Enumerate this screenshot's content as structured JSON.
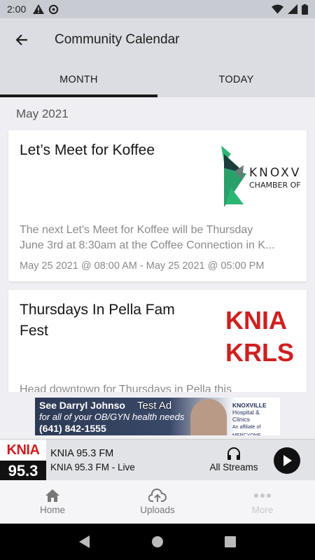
{
  "status_bar": {
    "time": "2:00"
  },
  "app_bar": {
    "title": "Community Calendar"
  },
  "tabs": [
    {
      "label": "MONTH"
    },
    {
      "label": "TODAY"
    }
  ],
  "calendar": {
    "month": "May 2021",
    "events": [
      {
        "title": "Let’s Meet for Koffee",
        "description_line1": "The next Let's Meet for Koffee will be Thursday",
        "description_line2": "June 3rd at 8:30am at the Coffee Connection in K...",
        "dates": "May 25 2021 @ 08:00 AM - May 25 2021 @ 05:00 PM",
        "thumb": {
          "line1": "KNOXV",
          "line2": "CHAMBER OF"
        }
      },
      {
        "title": "Thursdays In Pella Fam Fest",
        "description_line1": "Head downtown for Thursdays in Pella this",
        "thumb": {
          "line1": "KNIA",
          "line2": "KRLS"
        }
      }
    ]
  },
  "ad": {
    "headline": "See  Darryl Johnso",
    "line2": "for all of your OB/GYN health needs",
    "phone": "(641) 842-1555",
    "label": "Test Ad",
    "logo_line1": "KNOXVILLE",
    "logo_line2": "Hospital & Clinics",
    "logo_line3": "An affiliate of MERCYONE"
  },
  "player": {
    "logo_top": "KNIA",
    "logo_bottom": "95.3",
    "station": "KNIA 95.3 FM",
    "subtitle": "KNIA 95.3 FM - Live",
    "streams_label": "All Streams"
  },
  "bottom_nav": [
    {
      "label": "Home",
      "icon": "home-icon"
    },
    {
      "label": "Uploads",
      "icon": "cloud-upload-icon"
    },
    {
      "label": "More",
      "icon": "more-dots-icon"
    }
  ],
  "colors": {
    "accent_red": "#cf1f1f",
    "tab_indicator": "#1a1a1a",
    "bar_bg": "#dcdde3"
  }
}
